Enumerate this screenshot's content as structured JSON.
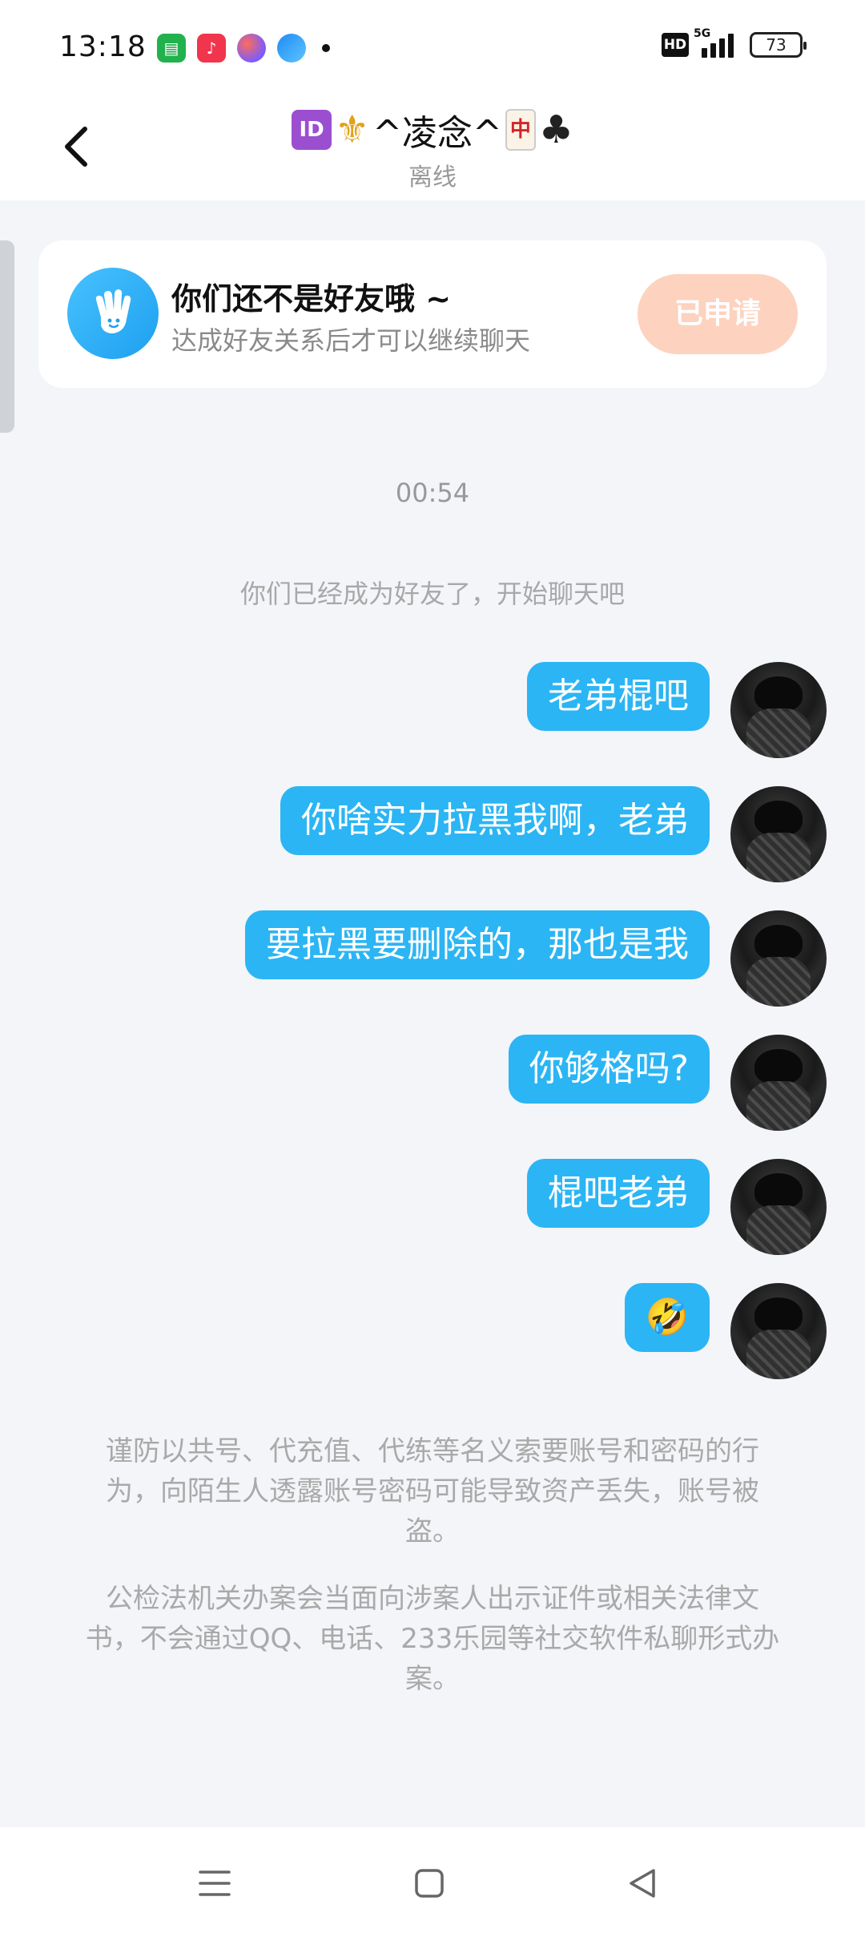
{
  "status_bar": {
    "time": "13:18",
    "app_icons": [
      "green-app-icon",
      "music-app-icon",
      "paint-app-icon",
      "browser-app-icon"
    ],
    "hd_label": "HD",
    "network_label": "5G",
    "battery_level": "73"
  },
  "header": {
    "title_name": "^凌念^",
    "subtitle": "离线",
    "title_decorations": [
      "ID-badge-icon",
      "fleur-de-lis-icon",
      "mahjong-tile-icon",
      "club-suit-icon"
    ]
  },
  "friend_card": {
    "title": "你们还不是好友哦 ~",
    "subtitle": "达成好友关系后才可以继续聊天",
    "button_label": "已申请"
  },
  "chat": {
    "timestamp": "00:54",
    "system_message": "你们已经成为好友了，开始聊天吧",
    "messages": [
      {
        "text": "老弟棍吧",
        "sender": "self"
      },
      {
        "text": "你啥实力拉黑我啊，老弟",
        "sender": "self"
      },
      {
        "text": "要拉黑要删除的，那也是我",
        "sender": "self"
      },
      {
        "text": "你够格吗?",
        "sender": "self"
      },
      {
        "text": "棍吧老弟",
        "sender": "self"
      },
      {
        "text": "🤣",
        "sender": "self"
      }
    ]
  },
  "warnings": [
    "谨防以共号、代充值、代练等名义索要账号和密码的行为，向陌生人透露账号密码可能导致资产丢失，账号被盗。",
    "公检法机关办案会当面向涉案人出示证件或相关法律文书，不会通过QQ、电话、233乐园等社交软件私聊形式办案。"
  ],
  "nav_bar": {
    "buttons": [
      "menu-icon",
      "home-icon",
      "back-triangle-icon"
    ]
  },
  "colors": {
    "bubble": "#2bb5f4",
    "applied_button": "#fdd2bf",
    "background": "#f3f5f8"
  }
}
